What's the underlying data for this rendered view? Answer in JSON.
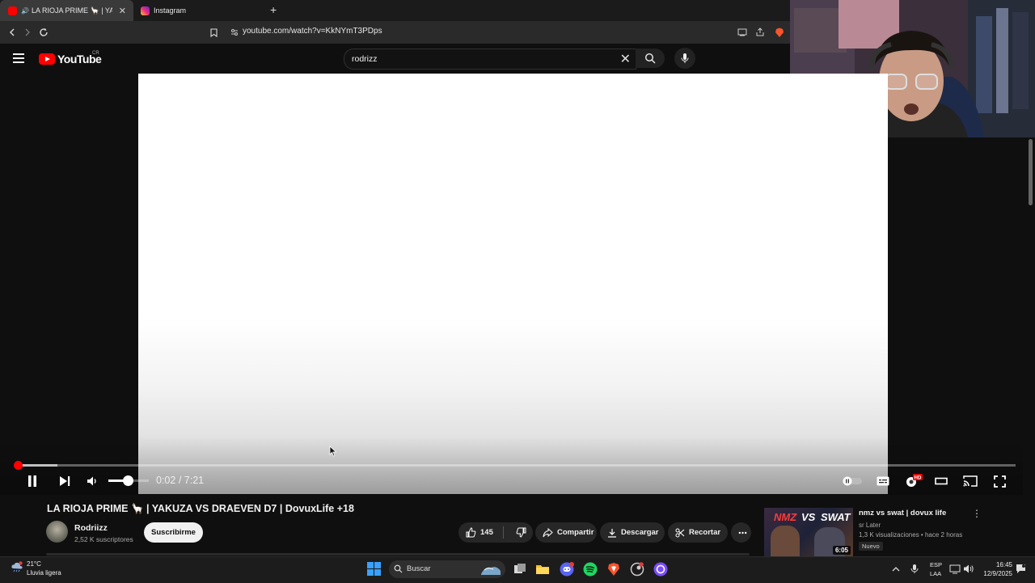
{
  "browser": {
    "tabs": [
      {
        "label": "LA RIOJA PRIME 🦙 | YAKUZA",
        "active": true
      },
      {
        "label": "Instagram",
        "active": false
      }
    ],
    "new_tab_symbol": "+",
    "url": "youtube.com/watch?v=KkNYmT3PDps"
  },
  "youtube": {
    "logo_text": "YouTube",
    "country_code": "CR",
    "search_value": "rodrizz",
    "accent_color": "#ff0000"
  },
  "player": {
    "current_time": "0:02",
    "separator": " / ",
    "duration": "7:21",
    "progress_fraction": 0.004,
    "buffered_fraction": 0.04,
    "volume_fraction": 0.5
  },
  "video": {
    "title": "LA RIOJA PRIME 🦙 | YAKUZA VS DRAEVEN D7 | DovuxLife +18",
    "channel_name": "Rodriizz",
    "subscribers": "2,52 K suscriptores",
    "subscribe_label": "Suscribirme",
    "likes": "145",
    "share_label": "Compartir",
    "download_label": "Descargar",
    "clip_label": "Recortar"
  },
  "recommendation": {
    "title": "nmz vs swat | dovux life",
    "channel": "sr Later",
    "meta": "1,3 K visualizaciones • hace 2 horas",
    "badge": "Nuevo",
    "duration": "6:05",
    "thumb_text_left": "NMZ",
    "thumb_text_mid": "VS",
    "thumb_text_right": "SWAT"
  },
  "taskbar": {
    "temperature": "21°C",
    "weather": "Lluvia ligera",
    "search_label": "Buscar",
    "lang_top": "ESP",
    "lang_bottom": "LAA",
    "time": "16:45",
    "date": "12/9/2025"
  }
}
